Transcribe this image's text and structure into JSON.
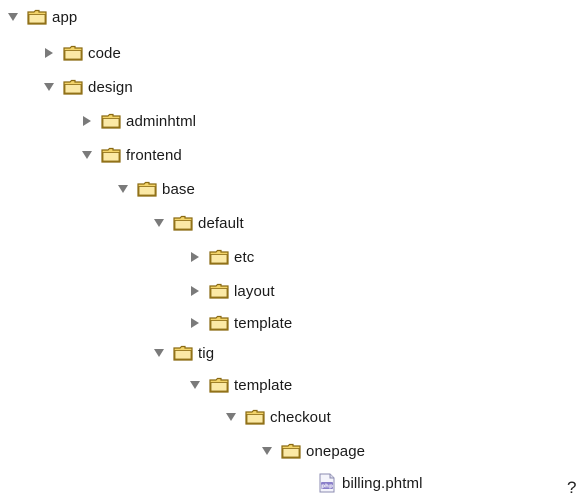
{
  "tree": {
    "items": [
      {
        "label": "app",
        "type": "folder",
        "state": "expanded",
        "depth": 0
      },
      {
        "label": "code",
        "type": "folder",
        "state": "collapsed",
        "depth": 1
      },
      {
        "label": "design",
        "type": "folder",
        "state": "expanded",
        "depth": 1
      },
      {
        "label": "adminhtml",
        "type": "folder",
        "state": "collapsed",
        "depth": 2
      },
      {
        "label": "frontend",
        "type": "folder",
        "state": "expanded",
        "depth": 2
      },
      {
        "label": "base",
        "type": "folder",
        "state": "expanded",
        "depth": 3
      },
      {
        "label": "default",
        "type": "folder",
        "state": "expanded",
        "depth": 4
      },
      {
        "label": "etc",
        "type": "folder",
        "state": "collapsed",
        "depth": 5
      },
      {
        "label": "layout",
        "type": "folder",
        "state": "collapsed",
        "depth": 5
      },
      {
        "label": "template",
        "type": "folder",
        "state": "collapsed",
        "depth": 5
      },
      {
        "label": "tig",
        "type": "folder",
        "state": "expanded",
        "depth": 4
      },
      {
        "label": "template",
        "type": "folder",
        "state": "expanded",
        "depth": 5
      },
      {
        "label": "checkout",
        "type": "folder",
        "state": "expanded",
        "depth": 6
      },
      {
        "label": "onepage",
        "type": "folder",
        "state": "expanded",
        "depth": 7
      },
      {
        "label": "billing.phtml",
        "type": "file",
        "state": "none",
        "depth": 8
      }
    ]
  },
  "annotation": {
    "text": "?"
  },
  "colors": {
    "folder_fill": "#f3d46a",
    "folder_stroke": "#8a6a12",
    "triangle": "#7a7a7a",
    "text": "#1a1a1a"
  },
  "icons": {
    "folder": "folder-icon",
    "file": "php-file-icon",
    "expanded": "triangle-down-icon",
    "collapsed": "triangle-right-icon"
  }
}
